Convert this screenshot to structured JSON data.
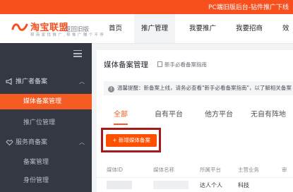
{
  "top_notice": "PC端旧版后台-钻件推广下线",
  "header": {
    "brand": "淘宝联盟",
    "slogan": "帮 商 家 找 推 广 , 帮 推 广 赚 个 不 停",
    "back_old": "返回旧版",
    "nav": [
      {
        "label": "首页"
      },
      {
        "label": "推广管理"
      },
      {
        "label": "我要推广"
      },
      {
        "label": "我要招商"
      },
      {
        "label": "效"
      }
    ]
  },
  "sidebar": {
    "sections": [
      {
        "label": "推广者备案",
        "icon": "megaphone-icon"
      },
      {
        "label": "媒体备案管理"
      },
      {
        "label": "推广位管理"
      },
      {
        "label": "服务商备案",
        "icon": "handshake-icon"
      },
      {
        "label": "备案管理"
      },
      {
        "label": "身份管理"
      }
    ]
  },
  "main": {
    "title": "媒体备案管理",
    "guide_link": "新手必看备案指南",
    "alert": "温馨提醒：新备案上线，请务必查看\"新手必看备案指南\"，以了解相关备案",
    "tabs": [
      {
        "label": "全部"
      },
      {
        "label": "自有平台"
      },
      {
        "label": "他方平台"
      },
      {
        "label": "无自有阵地"
      }
    ],
    "add_button": "+ 新增媒体备案",
    "table": {
      "headers": [
        "媒体ID",
        "媒体名称",
        "所属平台",
        "主营业务",
        "审"
      ],
      "rows": [
        {
          "platform": "达人个人",
          "business": "科技"
        }
      ]
    }
  },
  "colors": {
    "brand": "#f7501e",
    "accent": "#f55b22",
    "sidebar_bg": "#343843",
    "highlight": "#a8191a"
  }
}
